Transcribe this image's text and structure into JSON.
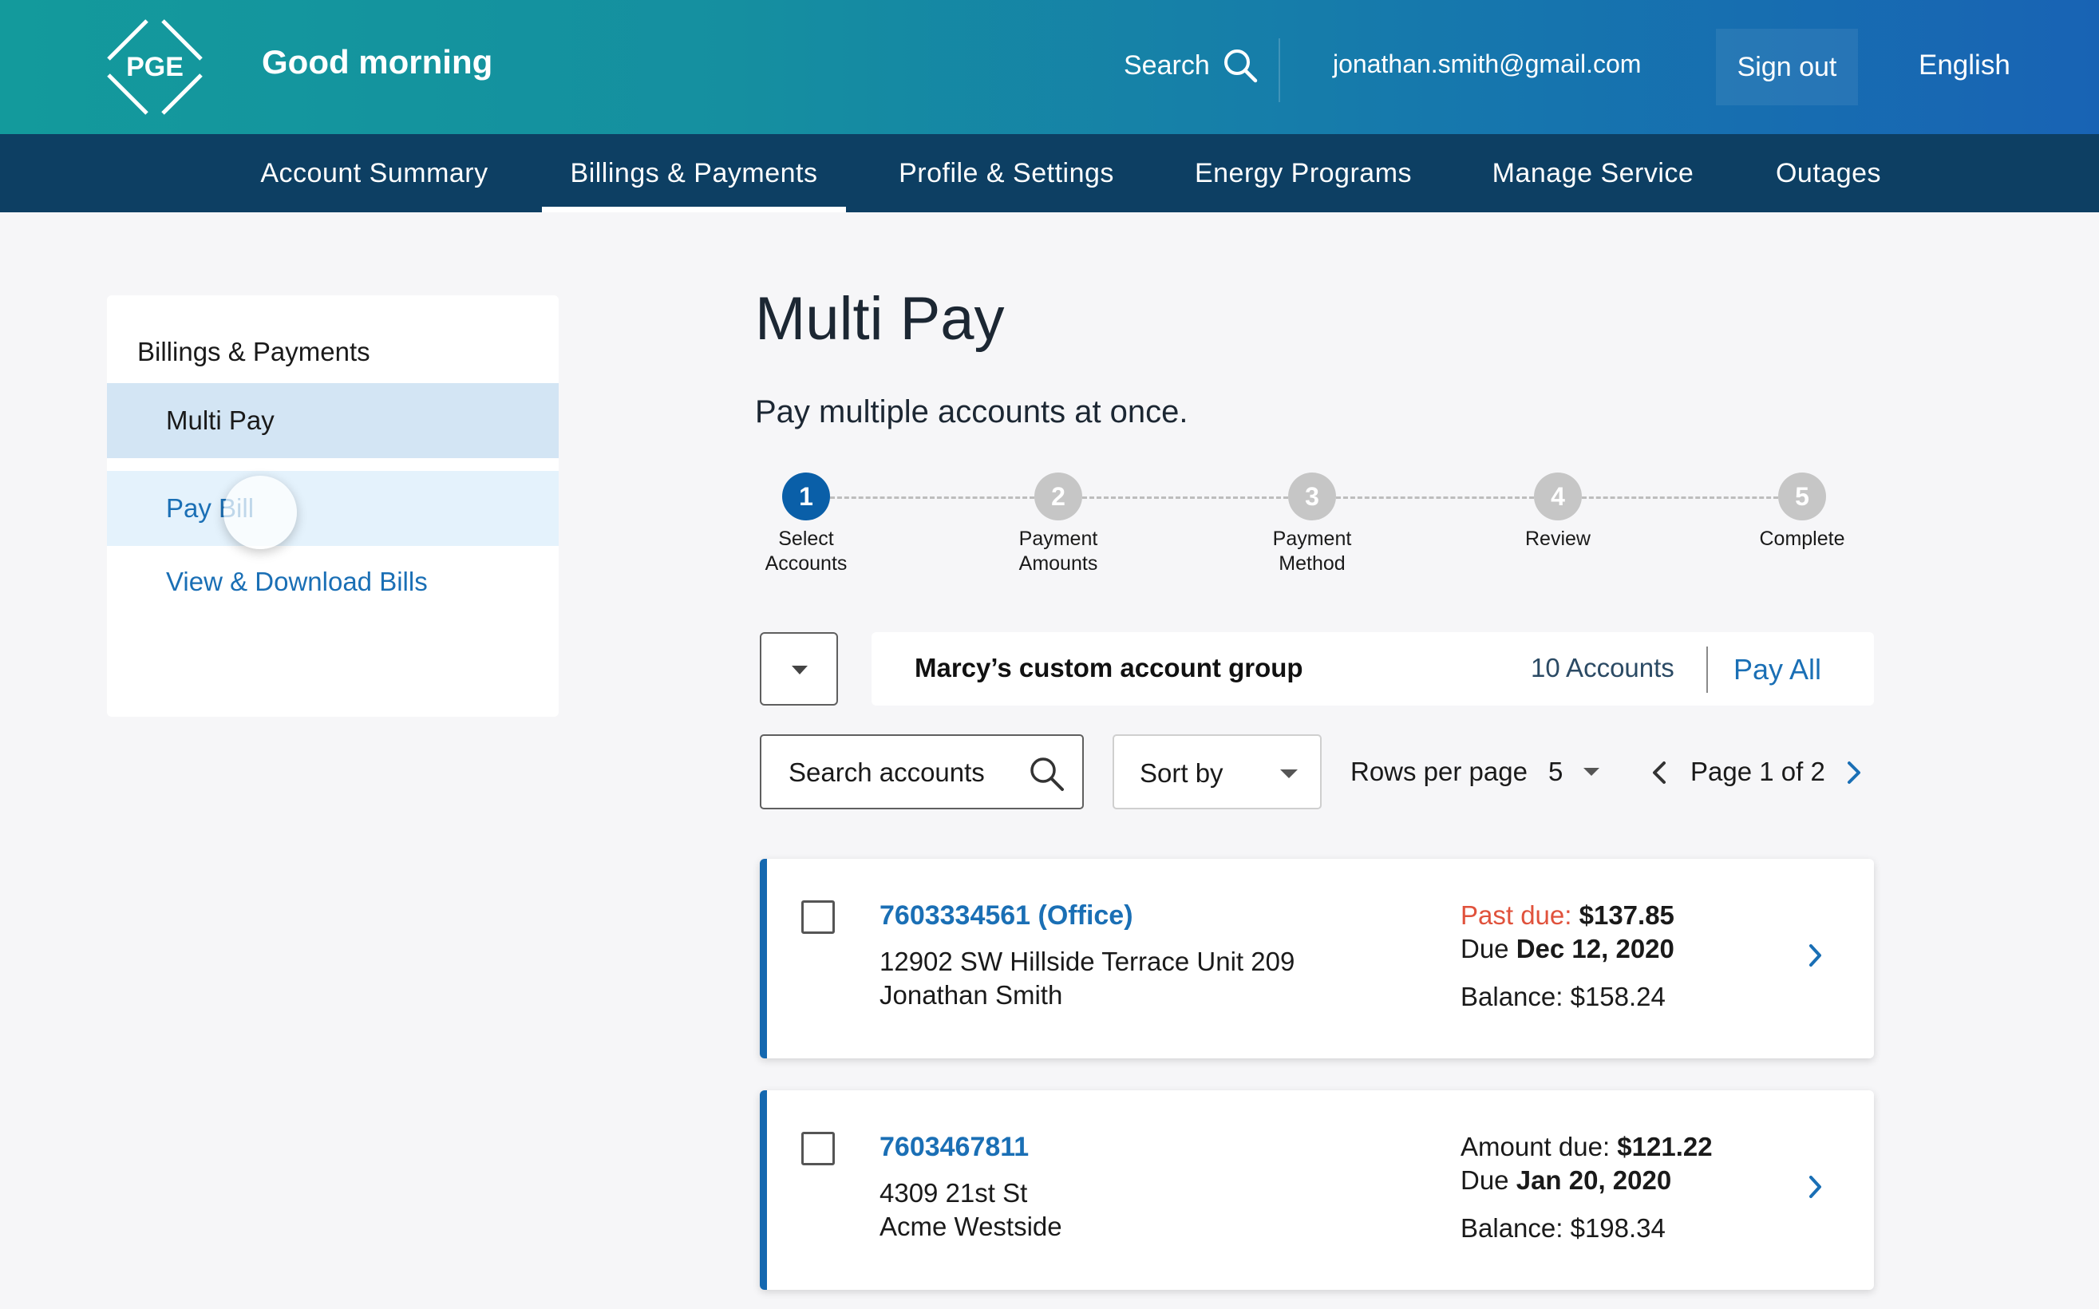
{
  "header": {
    "logo_text": "PGE",
    "greeting": "Good morning",
    "search_label": "Search",
    "user_email": "jonathan.smith@gmail.com",
    "signout_label": "Sign out",
    "language": "English"
  },
  "nav": {
    "tabs": [
      {
        "label": "Account Summary"
      },
      {
        "label": "Billings & Payments"
      },
      {
        "label": "Profile & Settings"
      },
      {
        "label": "Energy Programs"
      },
      {
        "label": "Manage Service"
      },
      {
        "label": "Outages"
      }
    ]
  },
  "sidebar": {
    "title": "Billings & Payments",
    "items": [
      {
        "label": "Multi Pay"
      },
      {
        "label": "Pay Bill"
      },
      {
        "label": "View & Download Bills"
      }
    ]
  },
  "main": {
    "title": "Multi Pay",
    "subtitle": "Pay multiple accounts at once.",
    "steps": [
      {
        "num": "1",
        "label_1": "Select",
        "label_2": "Accounts"
      },
      {
        "num": "2",
        "label_1": "Payment",
        "label_2": "Amounts"
      },
      {
        "num": "3",
        "label_1": "Payment",
        "label_2": "Method"
      },
      {
        "num": "4",
        "label_1": "Review",
        "label_2": ""
      },
      {
        "num": "5",
        "label_1": "Complete",
        "label_2": ""
      }
    ],
    "group": {
      "name": "Marcy’s custom account group",
      "count": "10 Accounts",
      "pay_all": "Pay All"
    },
    "filters": {
      "search_placeholder": "Search accounts",
      "sort_label": "Sort by",
      "rows_label": "Rows per page",
      "rows_value": "5",
      "page_label": "Page 1 of 2"
    },
    "accounts": [
      {
        "number": "7603334561 (Office)",
        "address": "12902 SW Hillside Terrace Unit 209",
        "owner": "Jonathan Smith",
        "due_label": "Past due:",
        "due_amount": "$137.85",
        "due_prefix": "Due",
        "due_date": "Dec 12, 2020",
        "balance": "Balance: $158.24"
      },
      {
        "number": "7603467811",
        "address": "4309 21st St",
        "owner": "Acme Westside",
        "due_label": "Amount due:",
        "due_amount": "$121.22",
        "due_prefix": "Due",
        "due_date": "Jan 20, 2020",
        "balance": "Balance: $198.34"
      }
    ]
  },
  "colors": {
    "header_start": "#139a9c",
    "header_end": "#1863b4",
    "nav": "#0d3f63",
    "accent": "#1a6fb5",
    "past_due": "#e0523c"
  }
}
